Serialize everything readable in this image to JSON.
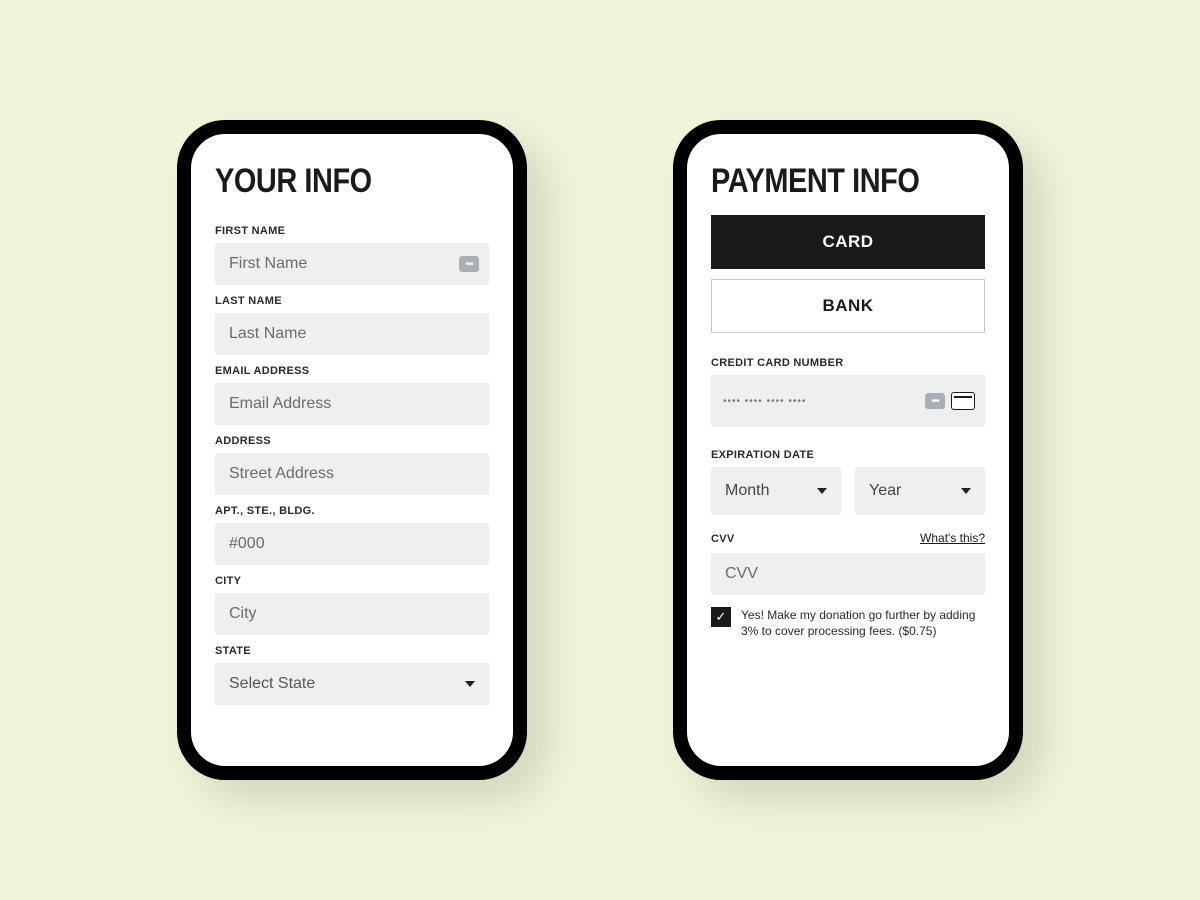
{
  "your_info": {
    "heading": "YOUR INFO",
    "first_name": {
      "label": "FIRST NAME",
      "placeholder": "First Name"
    },
    "last_name": {
      "label": "LAST NAME",
      "placeholder": "Last Name"
    },
    "email": {
      "label": "EMAIL ADDRESS",
      "placeholder": "Email Address"
    },
    "address": {
      "label": "ADDRESS",
      "placeholder": "Street Address"
    },
    "apt": {
      "label": "APT., STE., BLDG.",
      "placeholder": "#000"
    },
    "city": {
      "label": "CITY",
      "placeholder": "City"
    },
    "state": {
      "label": "STATE",
      "selected": "Select State"
    }
  },
  "payment": {
    "heading": "PAYMENT INFO",
    "tab_card": "CARD",
    "tab_bank": "BANK",
    "cc_label": "CREDIT CARD NUMBER",
    "cc_mask": "•••• •••• •••• ••••",
    "exp_label": "EXPIRATION DATE",
    "month_placeholder": "Month",
    "year_placeholder": "Year",
    "cvv_label": "CVV",
    "whats_this": "What's this?",
    "cvv_placeholder": "CVV",
    "fee_checked": true,
    "fee_text": "Yes! Make my donation go further by adding 3% to cover processing fees. ($0.75)"
  }
}
